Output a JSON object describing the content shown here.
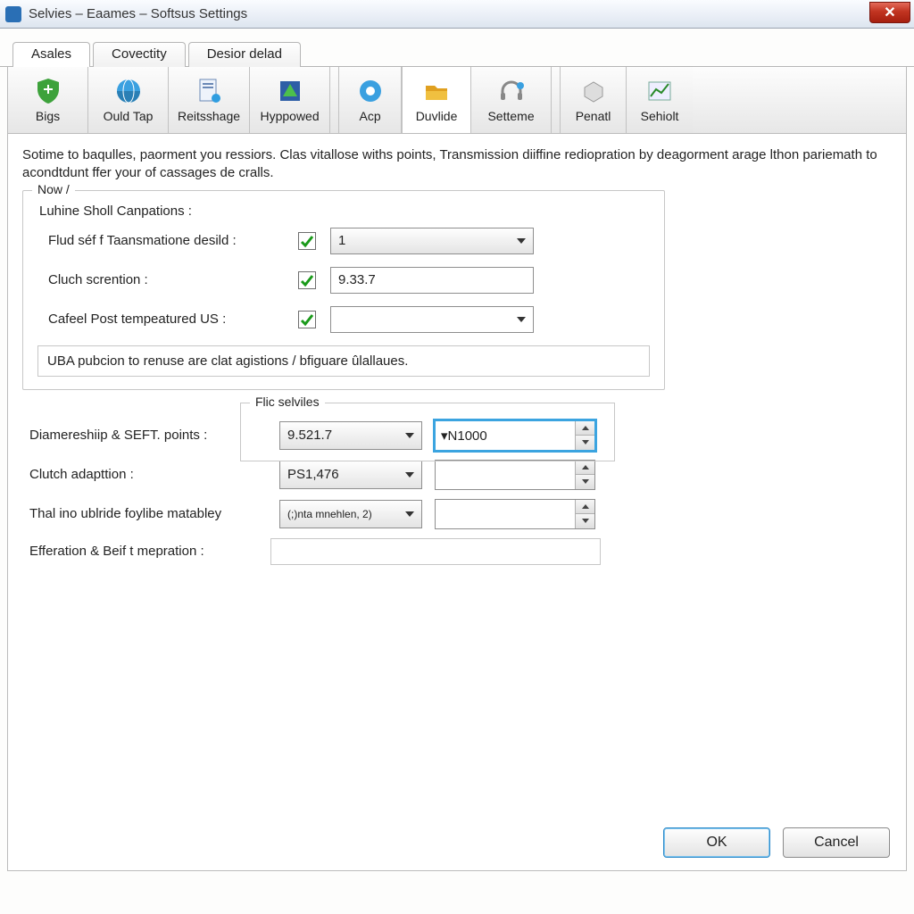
{
  "window": {
    "title": "Selvies – Eaames – Softsus Settings",
    "close_glyph": "✕"
  },
  "upper_tabs": [
    {
      "label": "Asales",
      "active": true
    },
    {
      "label": "Covectity",
      "active": false
    },
    {
      "label": "Desior delad",
      "active": false
    }
  ],
  "toolbar": [
    {
      "id": "bigs",
      "label": "Bigs",
      "icon": "shield-icon",
      "active": false
    },
    {
      "id": "ould-tap",
      "label": "Ould Tap",
      "icon": "globe-icon",
      "active": false
    },
    {
      "id": "reitsshage",
      "label": "Reitsshage",
      "icon": "note-icon",
      "active": false
    },
    {
      "id": "hyppowed",
      "label": "Hyppowed",
      "icon": "triangle-icon",
      "active": false
    },
    {
      "id": "acp",
      "label": "Acp",
      "icon": "gear-icon",
      "active": false
    },
    {
      "id": "duvide",
      "label": "Duvlide",
      "icon": "folder-icon",
      "active": true
    },
    {
      "id": "setteme",
      "label": "Setteme",
      "icon": "headset-icon",
      "active": false
    },
    {
      "id": "penati",
      "label": "Penatl",
      "icon": "cube-icon",
      "active": false
    },
    {
      "id": "sehiolt",
      "label": "Sehiolt",
      "icon": "chart-icon",
      "active": false
    }
  ],
  "description": "Sotime to baqulles, paorment you ressiors. Clas vitallose withs points, Transmission diiffine rediopration by deagorment arage lthon pariemath to acondtdunt ffer your of cassages de cralls.",
  "group_now": {
    "title": "Now /",
    "subheading": "Luhine Sholl Canpations :",
    "rows": [
      {
        "label": "Flud séf f Taansmatione desild :",
        "checked": true,
        "type": "select",
        "value": "1"
      },
      {
        "label": "Cluch scrention :",
        "checked": true,
        "type": "text",
        "value": "9.33.7"
      },
      {
        "label": "Cafeel Post tempeatured US :",
        "checked": true,
        "type": "combo",
        "value": ""
      }
    ],
    "hint": "UBA pubcion to renuse are clat agistions / bfiguare ûlallaues."
  },
  "flic": {
    "title": "Flic selviles",
    "rows": [
      {
        "label": "Diamereshiip & SEFT. points :",
        "dd_value": "9.521.7",
        "spin_value": "▾N1000",
        "spin_focused": true
      },
      {
        "label": "Clutch adapttion :",
        "dd_value": "PS1,476",
        "spin_value": "",
        "spin_focused": false
      },
      {
        "label": "Thal ino ublride foylibe matabley",
        "dd_value": "(;)nta mnehlen, 2)",
        "spin_value": "",
        "spin_focused": false
      }
    ],
    "last_label": "Efferation & Beif t mepration :"
  },
  "buttons": {
    "ok": "OK",
    "cancel": "Cancel"
  }
}
